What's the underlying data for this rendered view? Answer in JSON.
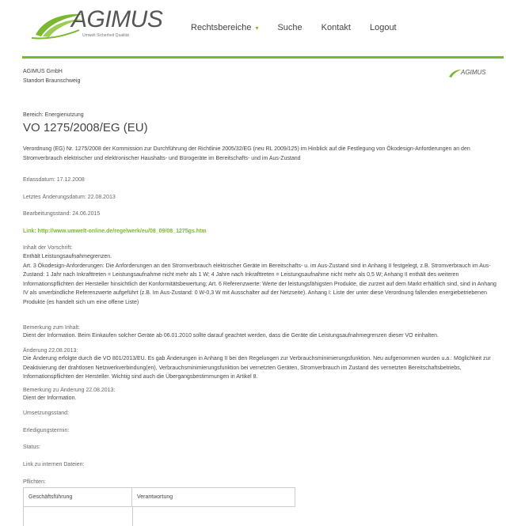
{
  "logo": {
    "brand": "AGIMUS",
    "tagline": "Umwelt Sicherheit Qualität"
  },
  "nav": {
    "items": [
      {
        "label": "Rechtsbereiche",
        "has_caret": true
      },
      {
        "label": "Suche"
      },
      {
        "label": "Kontakt"
      },
      {
        "label": "Logout"
      }
    ]
  },
  "company": {
    "name": "AGIMUS GmbH",
    "location": "Standort Braunschweig",
    "small_logo": "AGIMUS"
  },
  "doc": {
    "bereich": "Bereich: Energienutzung",
    "title": "VO 1275/2008/EG (EU)",
    "description": "Verordnung (EG) Nr. 1275/2008 der Kommission zur Durchführung der Richtlinie 2005/32/EG (neu RL 2009/125) im Hinblick auf die Festlegung von Ökodesign-Anforderungen an den Stromverbrauch elektrischer und elektronischer Haushalts- und Bürogeräte im Bereitschafts- und im Aus-Zustand",
    "erlassdatum": "Erlassdatum: 17.12.2008",
    "letztes": "Letztes Änderungsdatum: 22.08.2013",
    "bearbeitung": "Bearbeitungsstand: 24.06.2015",
    "link": "Link: http://www.umwelt-online.de/regelwerk/eu/08_09/08_1275gs.htm",
    "inhalt_label": "Inhalt der Vorschrift:",
    "inhalt_text": "Enthält Leistungsaufnahmegrenzen.\nArt. 3 Ökodesign-Anforderungen: Die Anforderungen an den Stromverbrauch elektrischer Geräte im Bereitschafts- u. im Aus-Zustand sind in Anhang II festgelegt, z.B. Stromverbrauch im Aus-Zustand: 1 Jahr nach Inkrafttreten = Leistungsaufnahme nicht mehr als 1 W; 4 Jahre nach Inkrafttreten = Leistungsaufnahme nicht mehr als 0,5 W; Anhang II enthält des weiteren Informationspflichten der Hersteller hinsichtlich der Konformitätsbewertung; Art. 6 Referenzwerte: Werte der leistungsfähigsten Produkte, die zurzeit auf dem Markt erhältlich sind, sind in Anhang IV als unverbindliche Referenzwerte aufgeführt (z.B. Im Aus-Zustand: 0 W-0,3 W mit Ausschalter auf der Netzseite). Anhang I: Liste der unter diese Verordnung fallenden energiebetriebenen Produkte (es handelt sich um eine offene Liste)",
    "bemerkung_label": "Bemerkung zum Inhalt:",
    "bemerkung_text": "Dient der Information. Beim Einkaufen solcher Geräte ab 06.01.2010 sollte darauf geachtet werden, dass die Geräte die Leistungsaufnahmegrenzen dieser VO einhalten.",
    "aenderung_label": "Änderung 22.08.2013:",
    "aenderung_text": "Die Änderung erfolgte durch die VO 801/2013/EU. Es gab Änderungen in Anhang II bei den Regelungen zur Verbrauchsminimierungsfunktion. Neu aufgenommen wurden u.a.: Möglichkeit zur Deaktivierung der drahtlosen Netzwerkverbindung(en), Verbrauchsminimierungsfunktion bei vernetzten Geräten, Stromverbrauch im Zustand des vernetzten Bereitschaftsbetriebs, Informationspflichten der Hersteller. Wichtig sind auch die Übergangsbestimmungen in Artikel 8.",
    "bem_aend_label": "Bemerkung zu Änderung 22.08.2013:",
    "bem_aend_text": "Dient der Information.",
    "umsetzung": "Umsetzungsstand:",
    "erledigung": "Erledigungstermin:",
    "status": "Status:",
    "intern": "Link zu internen Dateien:",
    "pflichten": "Pflichten:",
    "table": {
      "col1": "Geschäftsführung",
      "col2": "Verantwortung"
    }
  },
  "colors": {
    "accent": "#7ab82f",
    "text": "#444444"
  }
}
